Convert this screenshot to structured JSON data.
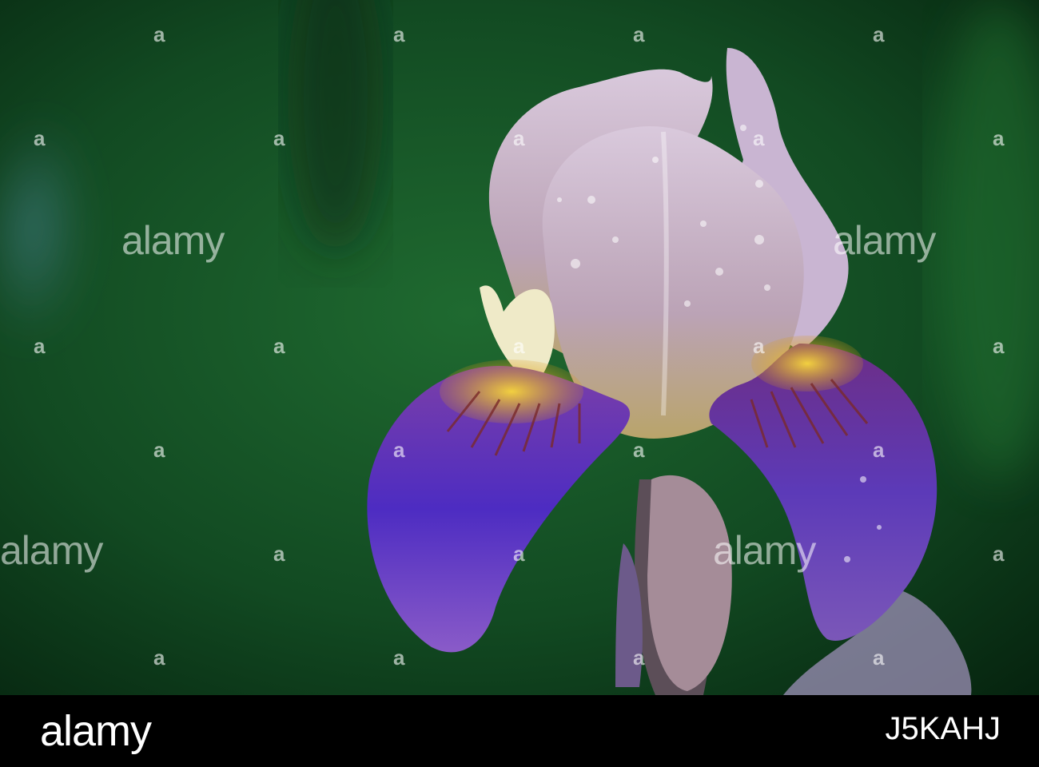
{
  "watermark": {
    "word": "alamy",
    "mark": "a"
  },
  "footer": {
    "logo": "alamy",
    "image_id": "J5KAHJ"
  },
  "colors": {
    "background_green": "#1c5a2a",
    "dark_green": "#0a2a14",
    "petal_standard": "#c7b0c6",
    "petal_fall": "#5a2fb0",
    "beard_yellow": "#e8b820"
  }
}
